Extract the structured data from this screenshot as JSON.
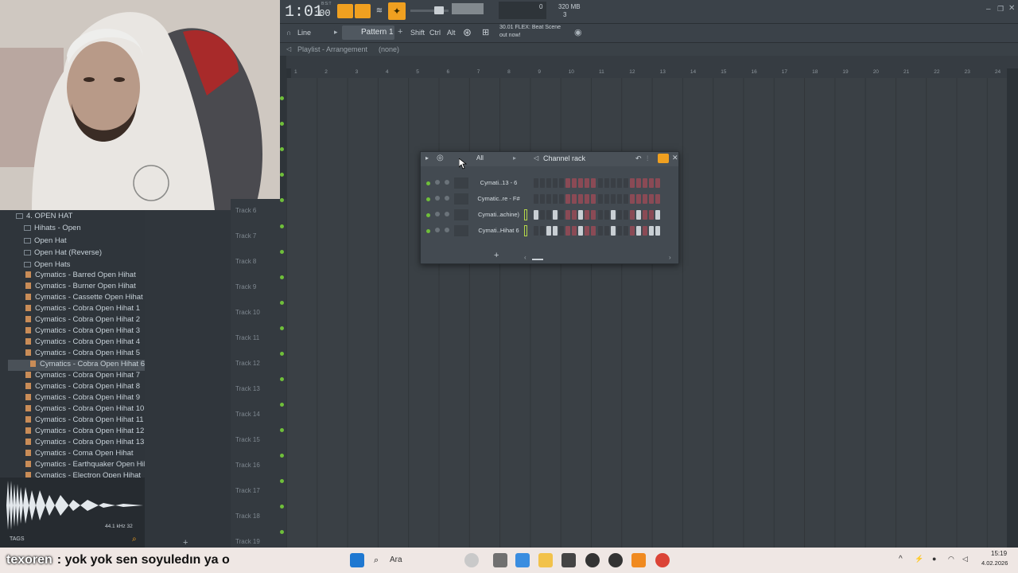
{
  "top": {
    "time_main": "1:01",
    "time_sub": ":00",
    "bst": "B:S:T",
    "memory": "320 MB",
    "cpu_value": "0",
    "poly_value": "3",
    "pattern": "Pattern 1",
    "line_mode": "Line",
    "shift": "Shift",
    "ctrl": "Ctrl",
    "alt": "Alt",
    "news_line1": "30.01  FLEX: Beat Scene",
    "news_line2": "out now!"
  },
  "playlist": {
    "title": "Playlist - Arrangement",
    "pattern_sel": "(none)",
    "ruler": [
      "1",
      "2",
      "3",
      "4",
      "5",
      "6",
      "7",
      "8",
      "9",
      "10",
      "11",
      "12",
      "13",
      "14",
      "15",
      "16",
      "17",
      "18",
      "19",
      "20",
      "21",
      "22",
      "23",
      "24"
    ],
    "tracks": [
      "Track 6",
      "Track 7",
      "Track 8",
      "Track 9",
      "Track 10",
      "Track 11",
      "Track 12",
      "Track 13",
      "Track 14",
      "Track 15",
      "Track 16",
      "Track 17",
      "Track 18",
      "Track 19"
    ]
  },
  "browser": {
    "folders": [
      {
        "label": "4. OPEN HAT"
      },
      {
        "label": "Hihats - Open"
      },
      {
        "label": "Open Hat"
      },
      {
        "label": "Open Hat (Reverse)"
      },
      {
        "label": "Open Hats"
      }
    ],
    "files": [
      "Cymatics - Barred Open Hihat",
      "Cymatics - Burner Open Hihat",
      "Cymatics - Cassette Open Hihat",
      "Cymatics - Cobra Open Hihat 1",
      "Cymatics - Cobra Open Hihat 2",
      "Cymatics - Cobra Open Hihat 3",
      "Cymatics - Cobra Open Hihat 4",
      "Cymatics - Cobra Open Hihat 5",
      "Cymatics - Cobra Open Hihat 6",
      "Cymatics - Cobra Open Hihat 7",
      "Cymatics - Cobra Open Hihat 8",
      "Cymatics - Cobra Open Hihat 9",
      "Cymatics - Cobra Open Hihat 10",
      "Cymatics - Cobra Open Hihat 11",
      "Cymatics - Cobra Open Hihat 12",
      "Cymatics - Cobra Open Hihat 13",
      "Cymatics - Coma Open Hihat",
      "Cymatics - Earthquaker Open Hihat",
      "Cymatics - Electron Open Hihat"
    ],
    "selected_index": 8,
    "sample_info": "44.1 kHz 32",
    "tags": "TAGS"
  },
  "channel_rack": {
    "title": "Channel rack",
    "filter": "All",
    "channels": [
      {
        "name": "Cymati..13 - 6",
        "steps": [
          0,
          0,
          0,
          0,
          0,
          1,
          1,
          1,
          1,
          1,
          0,
          0,
          0,
          0,
          0,
          1,
          1,
          1,
          1,
          1
        ]
      },
      {
        "name": "Cymatic..re - F#",
        "steps": [
          0,
          0,
          0,
          0,
          0,
          1,
          1,
          1,
          1,
          1,
          0,
          0,
          0,
          0,
          0,
          1,
          1,
          1,
          1,
          1
        ]
      },
      {
        "name": "Cymati..achine)",
        "steps": [
          2,
          0,
          0,
          2,
          0,
          1,
          1,
          2,
          1,
          1,
          0,
          0,
          2,
          0,
          0,
          1,
          2,
          1,
          1,
          2
        ]
      },
      {
        "name": "Cymati..Hihat 6",
        "steps": [
          0,
          0,
          2,
          2,
          0,
          1,
          1,
          2,
          1,
          1,
          0,
          0,
          2,
          0,
          0,
          1,
          2,
          1,
          2,
          2
        ]
      }
    ]
  },
  "stream": {
    "username": "texoren",
    "message": ": yok yok sen soyuledın ya o"
  },
  "taskbar": {
    "search": "Ara",
    "time": "15:19",
    "date": "4.02.2026"
  },
  "colors": {
    "accent": "#f0a020",
    "track_led": "#6fbf3a",
    "step_red": "#8a4a55",
    "browser_selected": "#4a5158"
  }
}
